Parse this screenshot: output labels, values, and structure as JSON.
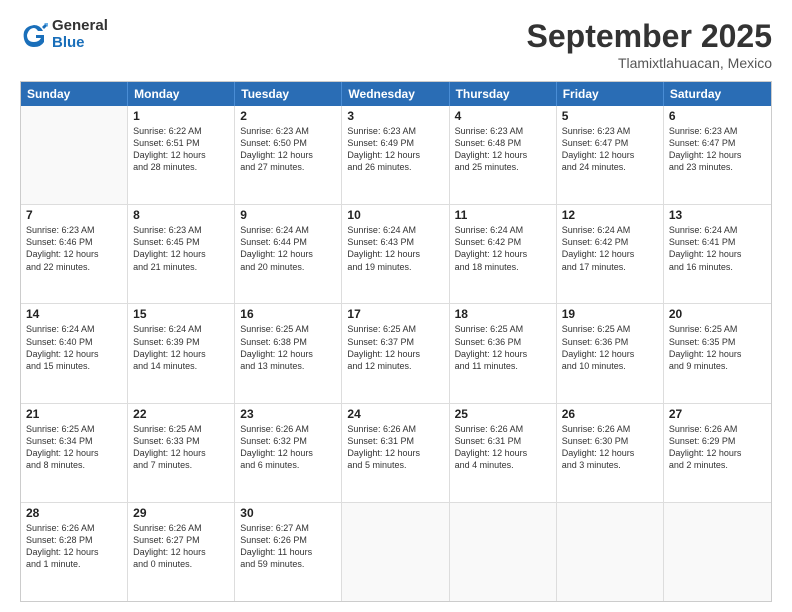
{
  "logo": {
    "general": "General",
    "blue": "Blue"
  },
  "title": "September 2025",
  "location": "Tlamixtlahuacan, Mexico",
  "header_days": [
    "Sunday",
    "Monday",
    "Tuesday",
    "Wednesday",
    "Thursday",
    "Friday",
    "Saturday"
  ],
  "rows": [
    [
      {
        "day": "",
        "lines": []
      },
      {
        "day": "1",
        "lines": [
          "Sunrise: 6:22 AM",
          "Sunset: 6:51 PM",
          "Daylight: 12 hours",
          "and 28 minutes."
        ]
      },
      {
        "day": "2",
        "lines": [
          "Sunrise: 6:23 AM",
          "Sunset: 6:50 PM",
          "Daylight: 12 hours",
          "and 27 minutes."
        ]
      },
      {
        "day": "3",
        "lines": [
          "Sunrise: 6:23 AM",
          "Sunset: 6:49 PM",
          "Daylight: 12 hours",
          "and 26 minutes."
        ]
      },
      {
        "day": "4",
        "lines": [
          "Sunrise: 6:23 AM",
          "Sunset: 6:48 PM",
          "Daylight: 12 hours",
          "and 25 minutes."
        ]
      },
      {
        "day": "5",
        "lines": [
          "Sunrise: 6:23 AM",
          "Sunset: 6:47 PM",
          "Daylight: 12 hours",
          "and 24 minutes."
        ]
      },
      {
        "day": "6",
        "lines": [
          "Sunrise: 6:23 AM",
          "Sunset: 6:47 PM",
          "Daylight: 12 hours",
          "and 23 minutes."
        ]
      }
    ],
    [
      {
        "day": "7",
        "lines": [
          "Sunrise: 6:23 AM",
          "Sunset: 6:46 PM",
          "Daylight: 12 hours",
          "and 22 minutes."
        ]
      },
      {
        "day": "8",
        "lines": [
          "Sunrise: 6:23 AM",
          "Sunset: 6:45 PM",
          "Daylight: 12 hours",
          "and 21 minutes."
        ]
      },
      {
        "day": "9",
        "lines": [
          "Sunrise: 6:24 AM",
          "Sunset: 6:44 PM",
          "Daylight: 12 hours",
          "and 20 minutes."
        ]
      },
      {
        "day": "10",
        "lines": [
          "Sunrise: 6:24 AM",
          "Sunset: 6:43 PM",
          "Daylight: 12 hours",
          "and 19 minutes."
        ]
      },
      {
        "day": "11",
        "lines": [
          "Sunrise: 6:24 AM",
          "Sunset: 6:42 PM",
          "Daylight: 12 hours",
          "and 18 minutes."
        ]
      },
      {
        "day": "12",
        "lines": [
          "Sunrise: 6:24 AM",
          "Sunset: 6:42 PM",
          "Daylight: 12 hours",
          "and 17 minutes."
        ]
      },
      {
        "day": "13",
        "lines": [
          "Sunrise: 6:24 AM",
          "Sunset: 6:41 PM",
          "Daylight: 12 hours",
          "and 16 minutes."
        ]
      }
    ],
    [
      {
        "day": "14",
        "lines": [
          "Sunrise: 6:24 AM",
          "Sunset: 6:40 PM",
          "Daylight: 12 hours",
          "and 15 minutes."
        ]
      },
      {
        "day": "15",
        "lines": [
          "Sunrise: 6:24 AM",
          "Sunset: 6:39 PM",
          "Daylight: 12 hours",
          "and 14 minutes."
        ]
      },
      {
        "day": "16",
        "lines": [
          "Sunrise: 6:25 AM",
          "Sunset: 6:38 PM",
          "Daylight: 12 hours",
          "and 13 minutes."
        ]
      },
      {
        "day": "17",
        "lines": [
          "Sunrise: 6:25 AM",
          "Sunset: 6:37 PM",
          "Daylight: 12 hours",
          "and 12 minutes."
        ]
      },
      {
        "day": "18",
        "lines": [
          "Sunrise: 6:25 AM",
          "Sunset: 6:36 PM",
          "Daylight: 12 hours",
          "and 11 minutes."
        ]
      },
      {
        "day": "19",
        "lines": [
          "Sunrise: 6:25 AM",
          "Sunset: 6:36 PM",
          "Daylight: 12 hours",
          "and 10 minutes."
        ]
      },
      {
        "day": "20",
        "lines": [
          "Sunrise: 6:25 AM",
          "Sunset: 6:35 PM",
          "Daylight: 12 hours",
          "and 9 minutes."
        ]
      }
    ],
    [
      {
        "day": "21",
        "lines": [
          "Sunrise: 6:25 AM",
          "Sunset: 6:34 PM",
          "Daylight: 12 hours",
          "and 8 minutes."
        ]
      },
      {
        "day": "22",
        "lines": [
          "Sunrise: 6:25 AM",
          "Sunset: 6:33 PM",
          "Daylight: 12 hours",
          "and 7 minutes."
        ]
      },
      {
        "day": "23",
        "lines": [
          "Sunrise: 6:26 AM",
          "Sunset: 6:32 PM",
          "Daylight: 12 hours",
          "and 6 minutes."
        ]
      },
      {
        "day": "24",
        "lines": [
          "Sunrise: 6:26 AM",
          "Sunset: 6:31 PM",
          "Daylight: 12 hours",
          "and 5 minutes."
        ]
      },
      {
        "day": "25",
        "lines": [
          "Sunrise: 6:26 AM",
          "Sunset: 6:31 PM",
          "Daylight: 12 hours",
          "and 4 minutes."
        ]
      },
      {
        "day": "26",
        "lines": [
          "Sunrise: 6:26 AM",
          "Sunset: 6:30 PM",
          "Daylight: 12 hours",
          "and 3 minutes."
        ]
      },
      {
        "day": "27",
        "lines": [
          "Sunrise: 6:26 AM",
          "Sunset: 6:29 PM",
          "Daylight: 12 hours",
          "and 2 minutes."
        ]
      }
    ],
    [
      {
        "day": "28",
        "lines": [
          "Sunrise: 6:26 AM",
          "Sunset: 6:28 PM",
          "Daylight: 12 hours",
          "and 1 minute."
        ]
      },
      {
        "day": "29",
        "lines": [
          "Sunrise: 6:26 AM",
          "Sunset: 6:27 PM",
          "Daylight: 12 hours",
          "and 0 minutes."
        ]
      },
      {
        "day": "30",
        "lines": [
          "Sunrise: 6:27 AM",
          "Sunset: 6:26 PM",
          "Daylight: 11 hours",
          "and 59 minutes."
        ]
      },
      {
        "day": "",
        "lines": []
      },
      {
        "day": "",
        "lines": []
      },
      {
        "day": "",
        "lines": []
      },
      {
        "day": "",
        "lines": []
      }
    ]
  ]
}
